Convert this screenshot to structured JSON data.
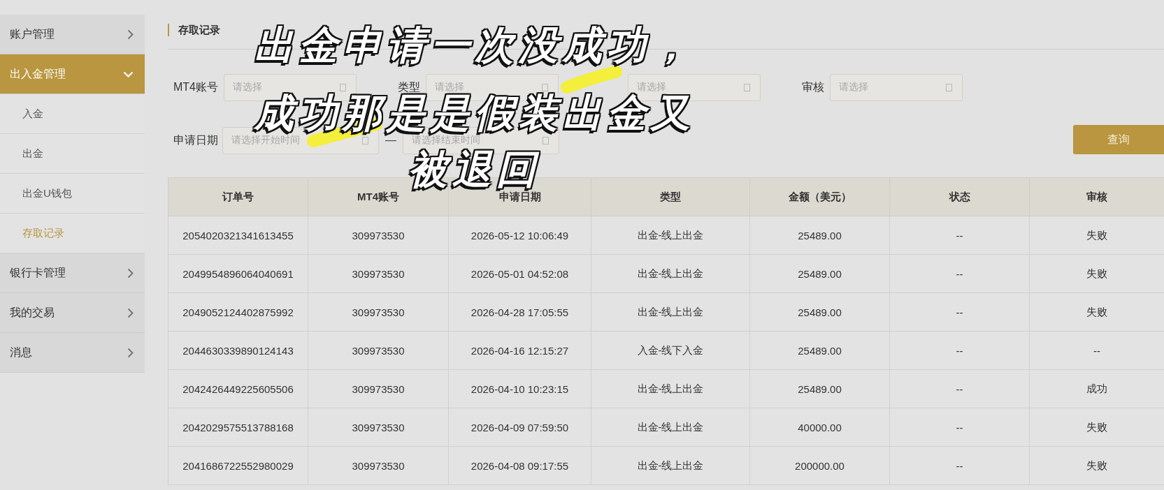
{
  "sidebar": {
    "items": [
      {
        "label": "账户管理",
        "expanded": false
      },
      {
        "label": "出入金管理",
        "expanded": true,
        "children": [
          {
            "label": "入金",
            "selected": false
          },
          {
            "label": "出金",
            "selected": false
          },
          {
            "label": "出金U钱包",
            "selected": false
          },
          {
            "label": "存取记录",
            "selected": true
          }
        ]
      },
      {
        "label": "银行卡管理",
        "expanded": false
      },
      {
        "label": "我的交易",
        "expanded": false
      },
      {
        "label": "消息",
        "expanded": false
      }
    ]
  },
  "page_title": "存取记录",
  "filters": [
    {
      "kind": "select",
      "label": "MT4账号",
      "placeholder": "请选择"
    },
    {
      "kind": "select",
      "label": "类型",
      "placeholder": "请选择"
    },
    {
      "kind": "select",
      "placeholder": "请选择"
    },
    {
      "kind": "select",
      "label": "审核",
      "placeholder": "请选择"
    },
    {
      "kind": "date_range",
      "label": "申请日期",
      "start": {
        "placeholder": "请选择开始时间"
      },
      "separator": "—",
      "end": {
        "placeholder": "请选择结束时间"
      }
    }
  ],
  "query_button": {
    "label": "查询"
  },
  "table": {
    "columns": [
      "订单号",
      "MT4账号",
      "申请日期",
      "类型",
      "金额（美元）",
      "状态",
      "审核"
    ],
    "rows": [
      [
        "2054020321341613455",
        "309973530",
        "2026-05-12 10:06:49",
        "出金-线上出金",
        "25489.00",
        "--",
        "失败"
      ],
      [
        "2049954896064040691",
        "309973530",
        "2026-05-01 04:52:08",
        "出金-线上出金",
        "25489.00",
        "--",
        "失败"
      ],
      [
        "2049052124402875992",
        "309973530",
        "2026-04-28 17:05:55",
        "出金-线上出金",
        "25489.00",
        "--",
        "失败"
      ],
      [
        "2044630339890124143",
        "309973530",
        "2026-04-16 12:15:27",
        "入金-线下入金",
        "25489.00",
        "--",
        "--"
      ],
      [
        "2042426449225605506",
        "309973530",
        "2026-04-10 10:23:15",
        "出金-线上出金",
        "25489.00",
        "--",
        "成功"
      ],
      [
        "2042029575513788168",
        "309973530",
        "2026-04-09 07:59:50",
        "出金-线上出金",
        "40000.00",
        "--",
        "失败"
      ],
      [
        "2041686722552980029",
        "309973530",
        "2026-04-08 09:17:55",
        "出金-线上出金",
        "200000.00",
        "--",
        "失败"
      ]
    ]
  },
  "caption": {
    "lines": [
      "出金申请一次没成功，",
      "成功那是是假装出金又",
      "被退回"
    ]
  }
}
